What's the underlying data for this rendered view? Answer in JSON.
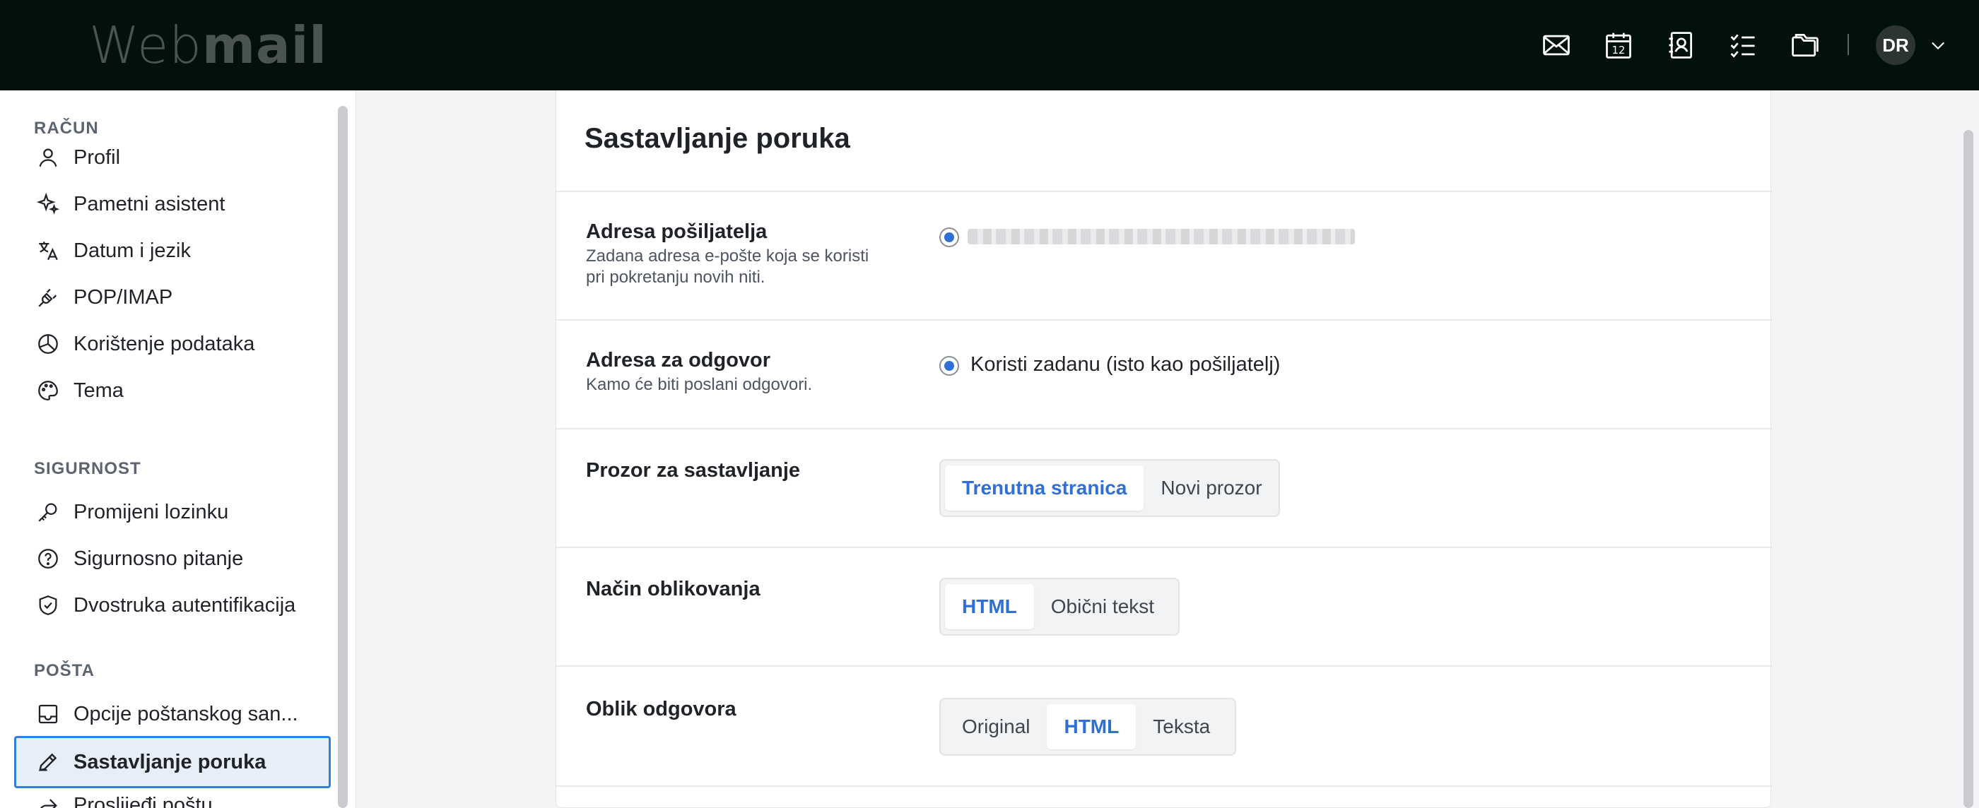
{
  "header": {
    "logo_light": "Web",
    "logo_bold": "mail",
    "avatar_initials": "DR",
    "icons": [
      "mail-icon",
      "calendar-icon",
      "contacts-icon",
      "tasks-icon",
      "folder-icon"
    ],
    "calendar_day": "12"
  },
  "sidebar": {
    "sections": [
      {
        "title": "RAČUN"
      },
      {
        "title": "SIGURNOST"
      },
      {
        "title": "POŠTA"
      }
    ],
    "items": [
      {
        "label": "Profil",
        "icon": "user-icon"
      },
      {
        "label": "Pametni asistent",
        "icon": "sparkle-icon"
      },
      {
        "label": "Datum i jezik",
        "icon": "translate-icon"
      },
      {
        "label": "POP/IMAP",
        "icon": "plug-icon"
      },
      {
        "label": "Korištenje podataka",
        "icon": "pie-chart-icon"
      },
      {
        "label": "Tema",
        "icon": "palette-icon"
      },
      {
        "label": "Promijeni lozinku",
        "icon": "key-icon"
      },
      {
        "label": "Sigurnosno pitanje",
        "icon": "question-circle-icon"
      },
      {
        "label": "Dvostruka autentifikacija",
        "icon": "shield-check-icon"
      },
      {
        "label": "Opcije poštanskog san...",
        "icon": "inbox-icon"
      },
      {
        "label": "Sastavljanje poruka",
        "icon": "pencil-icon",
        "active": true
      },
      {
        "label": "Proslijeđi poštu",
        "icon": "forward-icon"
      }
    ]
  },
  "main": {
    "title": "Sastavljanje poruka",
    "rows": [
      {
        "label": "Adresa pošiljatelja",
        "desc_line1": "Zadana adresa e-pošte koja se koristi",
        "desc_line2": "pri pokretanju novih niti."
      },
      {
        "label": "Adresa za odgovor",
        "desc_line1": "Kamo će biti poslani odgovori.",
        "option": "Koristi zadanu (isto kao pošiljatelj)"
      },
      {
        "label": "Prozor za sastavljanje",
        "options": [
          "Trenutna stranica",
          "Novi prozor"
        ],
        "selected": "Trenutna stranica"
      },
      {
        "label": "Način oblikovanja",
        "options": [
          "HTML",
          "Obični tekst"
        ],
        "selected": "HTML"
      },
      {
        "label": "Oblik odgovora",
        "options": [
          "Original",
          "HTML",
          "Teksta"
        ],
        "selected": "HTML"
      }
    ]
  },
  "colors": {
    "topbar": "#03110e",
    "accent": "#2f6fd6",
    "active_border": "#2f7fdc",
    "active_bg": "#e8eef7"
  }
}
